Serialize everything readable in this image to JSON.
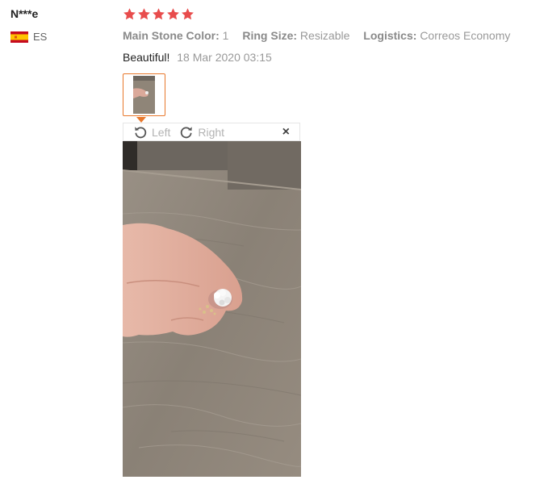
{
  "user": {
    "name": "N***e",
    "country_code": "ES",
    "flag_icon": "spain-flag-icon"
  },
  "rating": {
    "stars": 5,
    "max": 5,
    "color": "#e84c4c"
  },
  "attributes": [
    {
      "key": "Main Stone Color:",
      "value": "1"
    },
    {
      "key": "Ring Size:",
      "value": "Resizable"
    },
    {
      "key": "Logistics:",
      "value": "Correos Economy"
    }
  ],
  "review": {
    "text": "Beautiful!",
    "date": "18 Mar 2020 03:15"
  },
  "viewer": {
    "rotate_left_label": "Left",
    "rotate_right_label": "Right",
    "close_label": "×",
    "accent_color": "#e8782c"
  }
}
